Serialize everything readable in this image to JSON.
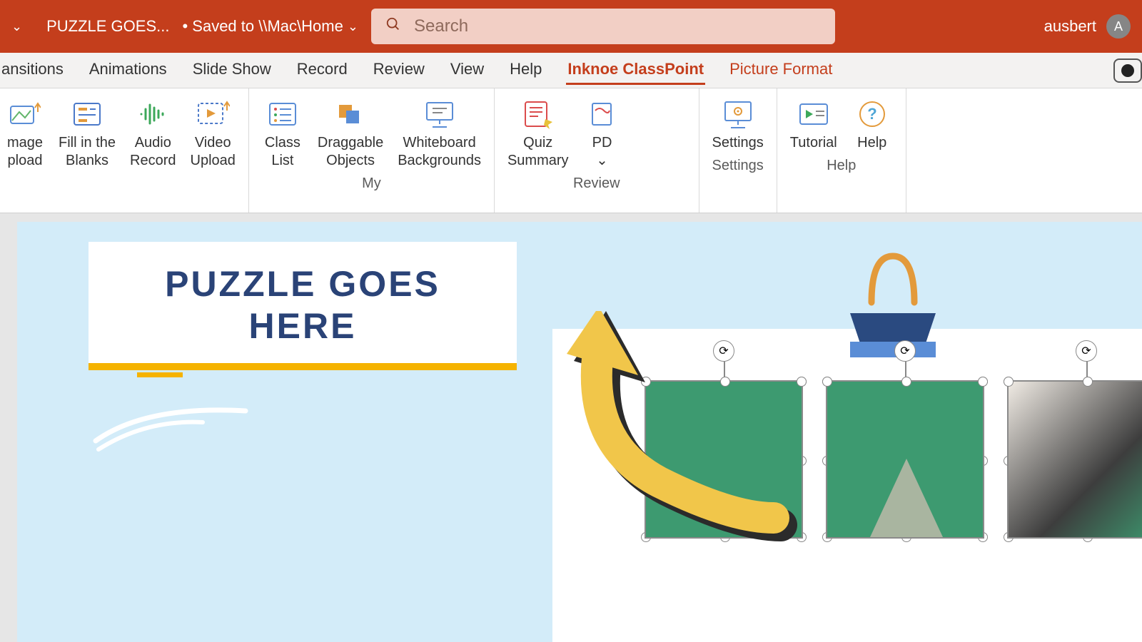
{
  "titlebar": {
    "doc_title": "PUZZLE GOES...",
    "saved_status": "• Saved to \\\\Mac\\Home"
  },
  "search": {
    "placeholder": "Search"
  },
  "user": {
    "name": "ausbert",
    "initial": "A"
  },
  "tabs": {
    "transitions": "ansitions",
    "animations": "Animations",
    "slideshow": "Slide Show",
    "record": "Record",
    "review": "Review",
    "view": "View",
    "help": "Help",
    "classpoint": "Inknoe ClassPoint",
    "picture_format": "Picture Format"
  },
  "ribbon": {
    "buttons": {
      "image_upload": "mage\npload",
      "fill_blanks": "Fill in the\nBlanks",
      "audio_record": "Audio\nRecord",
      "video_upload": "Video\nUpload",
      "class_list": "Class\nList",
      "draggable": "Draggable\nObjects",
      "whiteboard": "Whiteboard\nBackgrounds",
      "quiz": "Quiz\nSummary",
      "pdf": "PD",
      "pdf_chev": "⌄",
      "settings": "Settings",
      "tutorial": "Tutorial",
      "help": "Help"
    },
    "groups": {
      "my": "My",
      "review": "Review",
      "settings": "Settings",
      "help": "Help"
    }
  },
  "slide": {
    "title_line1": "PUZZLE GOES",
    "title_line2": "HERE"
  }
}
